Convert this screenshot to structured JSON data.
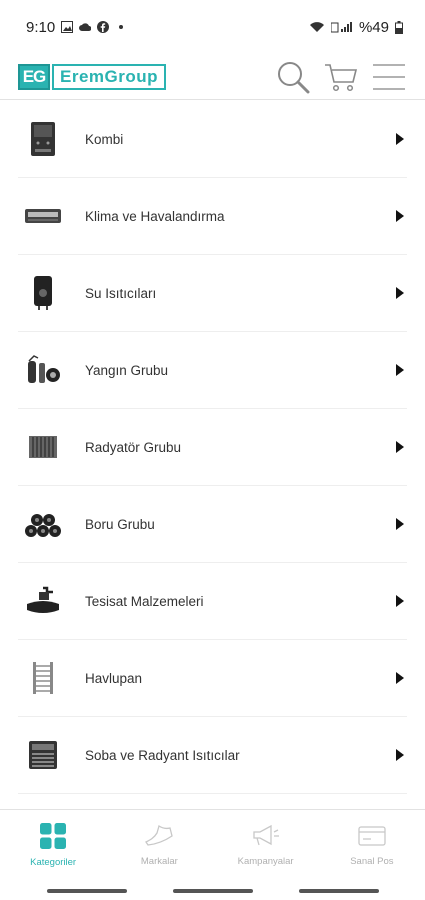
{
  "status_bar": {
    "time": "9:10",
    "battery": "%49"
  },
  "header": {
    "logo_mark": "EG",
    "logo_text": "EremGroup"
  },
  "categories": [
    {
      "label": "Kombi",
      "icon": "combi-boiler-icon"
    },
    {
      "label": "Klima ve Havalandırma",
      "icon": "air-conditioner-icon"
    },
    {
      "label": "Su Isıtıcıları",
      "icon": "water-heater-icon"
    },
    {
      "label": "Yangın Grubu",
      "icon": "fire-extinguisher-icon"
    },
    {
      "label": "Radyatör Grubu",
      "icon": "radiator-icon"
    },
    {
      "label": "Boru Grubu",
      "icon": "pipes-icon"
    },
    {
      "label": "Tesisat Malzemeleri",
      "icon": "faucet-icon"
    },
    {
      "label": "Havlupan",
      "icon": "towel-radiator-icon"
    },
    {
      "label": "Soba ve Radyant Isıtıcılar",
      "icon": "heater-icon"
    }
  ],
  "bottom_nav": [
    {
      "label": "Kategoriler",
      "active": true
    },
    {
      "label": "Markalar",
      "active": false
    },
    {
      "label": "Kampanyalar",
      "active": false
    },
    {
      "label": "Sanal Pos",
      "active": false
    }
  ],
  "colors": {
    "accent": "#2ab3b1",
    "inactive": "#b0b0b0"
  }
}
